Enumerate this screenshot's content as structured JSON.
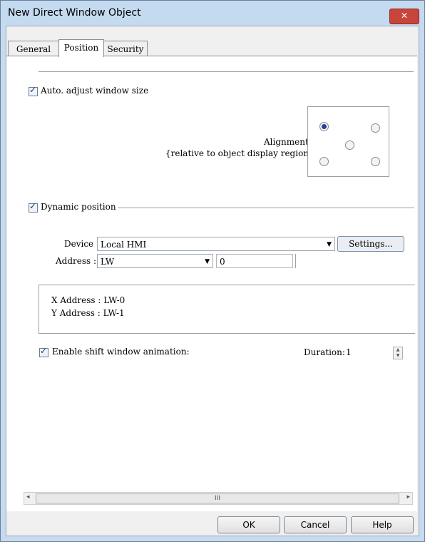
{
  "window": {
    "title": "New Direct Window Object",
    "close_glyph": "✕"
  },
  "tabs": [
    {
      "label": "General",
      "active": false
    },
    {
      "label": "Position",
      "active": true
    },
    {
      "label": "Security",
      "active": false
    }
  ],
  "auto_adjust": {
    "label": "Auto. adjust window size",
    "checked": true
  },
  "alignment": {
    "label": "Alignment:",
    "sublabel": "{relative to object display region}",
    "selected": "top-left",
    "options": [
      "top-left",
      "top-right",
      "center",
      "bottom-left",
      "bottom-right"
    ]
  },
  "dynamic_position": {
    "label": "Dynamic position",
    "checked": true
  },
  "device": {
    "label": "Device :",
    "value": "Local HMI",
    "settings_label": "Settings..."
  },
  "address": {
    "label": "Address :",
    "type_value": "LW",
    "number_value": "0"
  },
  "address_info": {
    "x_line": "X Address : LW-0",
    "y_line": "Y Address : LW-1"
  },
  "shift_animation": {
    "label": "Enable shift window animation:",
    "checked": true
  },
  "duration": {
    "label": "Duration:",
    "value": "1"
  },
  "scrollbar": {
    "grip": "III",
    "left_arrow": "◂",
    "right_arrow": "▸"
  },
  "buttons": {
    "ok": "OK",
    "cancel": "Cancel",
    "help": "Help"
  }
}
